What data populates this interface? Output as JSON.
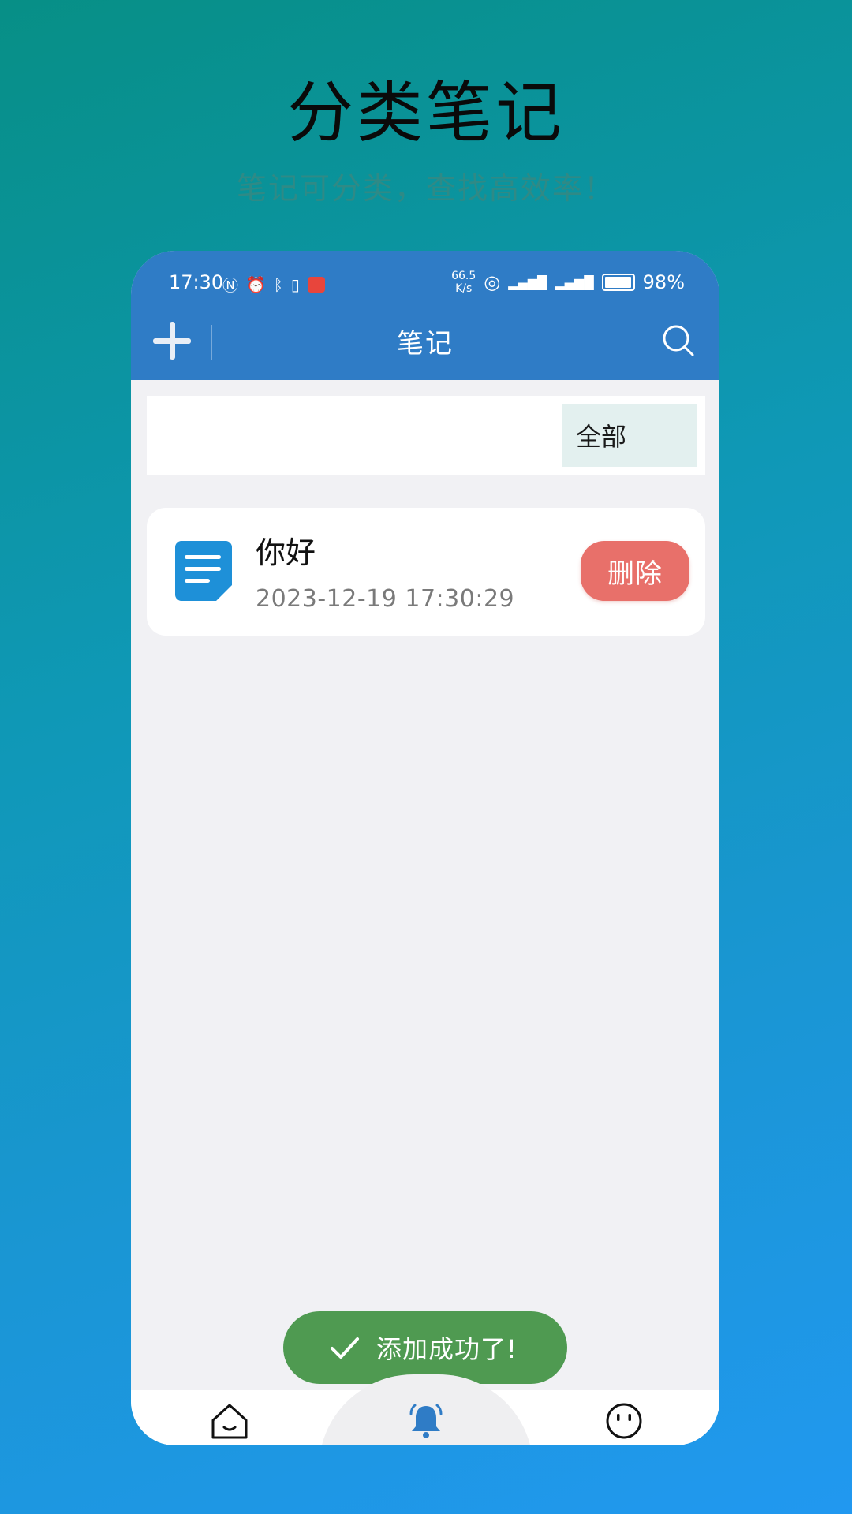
{
  "hero": {
    "title": "分类笔记",
    "subtitle": "笔记可分类，查找高效率！"
  },
  "status_bar": {
    "time": "17:30",
    "net_speed_value": "66.5",
    "net_speed_unit": "K/s",
    "battery": "98%"
  },
  "header": {
    "title": "笔记",
    "add_icon": "plus-icon",
    "search_icon": "search-icon"
  },
  "category": {
    "selected": "全部"
  },
  "notes": [
    {
      "title": "你好",
      "time": "2023-12-19 17:30:29",
      "delete_label": "删除",
      "icon": "document-icon"
    }
  ],
  "toast": {
    "text": "添加成功了!",
    "icon": "check-icon"
  },
  "bottom_nav": {
    "items": [
      "home-icon",
      "bell-icon",
      "face-icon"
    ]
  },
  "colors": {
    "header_blue": "#2f7cc6",
    "delete_red": "#e8706a",
    "toast_green": "#4f9a51",
    "note_icon_blue": "#1e90d8"
  }
}
